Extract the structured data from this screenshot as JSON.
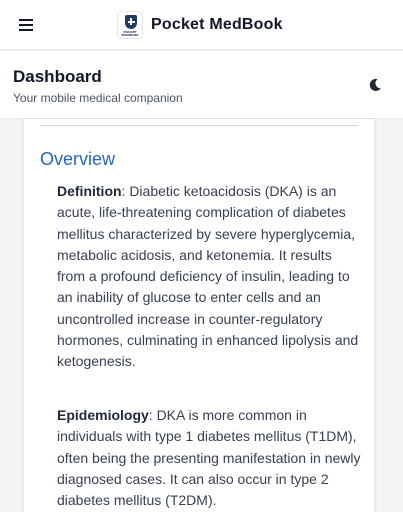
{
  "app": {
    "title": "Pocket MedBook",
    "logo_text": "POCKET MEDBOOK"
  },
  "header": {
    "title": "Dashboard",
    "subtitle": "Your mobile medical companion"
  },
  "content": {
    "section_title": "Overview",
    "definition": {
      "label": "Definition",
      "text": ": Diabetic ketoacidosis (DKA) is an acute, life-threatening complication of diabetes mellitus characterized by severe hyperglycemia, metabolic acidosis, and ketonemia. It results from a profound deficiency of insulin, leading to an inability of glucose to enter cells and an uncontrolled increase in counter-regulatory hormones, culminating in enhanced lipolysis and ketogenesis."
    },
    "epidemiology": {
      "label": "Epidemiology",
      "text": ": DKA is more common in individuals with type 1 diabetes mellitus (T1DM), often being the presenting manifestation in newly diagnosed cases. It can also occur in type 2 diabetes mellitus (T2DM)."
    }
  },
  "icons": {
    "menu": "hamburger-menu-icon",
    "theme": "moon-icon"
  },
  "colors": {
    "accent": "#2563c9",
    "logo": "#1f3a68",
    "text": "#374151"
  }
}
